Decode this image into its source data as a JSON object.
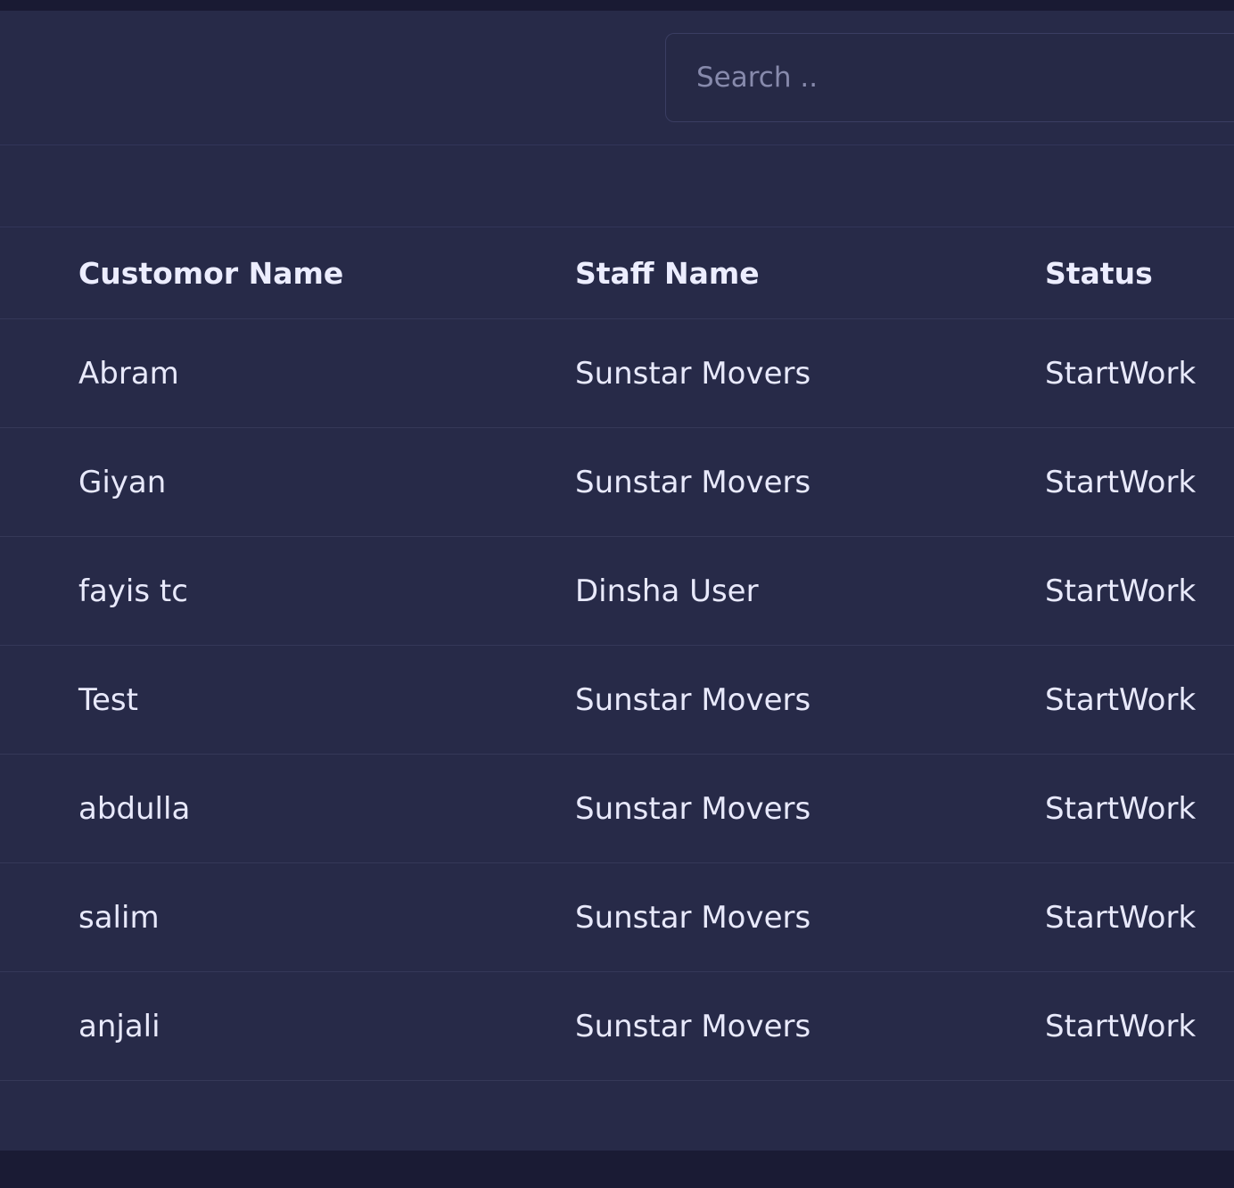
{
  "search": {
    "placeholder": "Search .."
  },
  "table": {
    "columns": [
      "Customor Name",
      "Staff Name",
      "Status"
    ],
    "rows": [
      {
        "customer": "Abram",
        "staff": "Sunstar Movers",
        "status": "StartWork"
      },
      {
        "customer": "Giyan",
        "staff": "Sunstar Movers",
        "status": "StartWork"
      },
      {
        "customer": "fayis tc",
        "staff": "Dinsha User",
        "status": "StartWork"
      },
      {
        "customer": "Test",
        "staff": "Sunstar Movers",
        "status": "StartWork"
      },
      {
        "customer": "abdulla",
        "staff": "Sunstar Movers",
        "status": "StartWork"
      },
      {
        "customer": "salim",
        "staff": "Sunstar Movers",
        "status": "StartWork"
      },
      {
        "customer": "anjali",
        "staff": "Sunstar Movers",
        "status": "StartWork"
      }
    ]
  }
}
